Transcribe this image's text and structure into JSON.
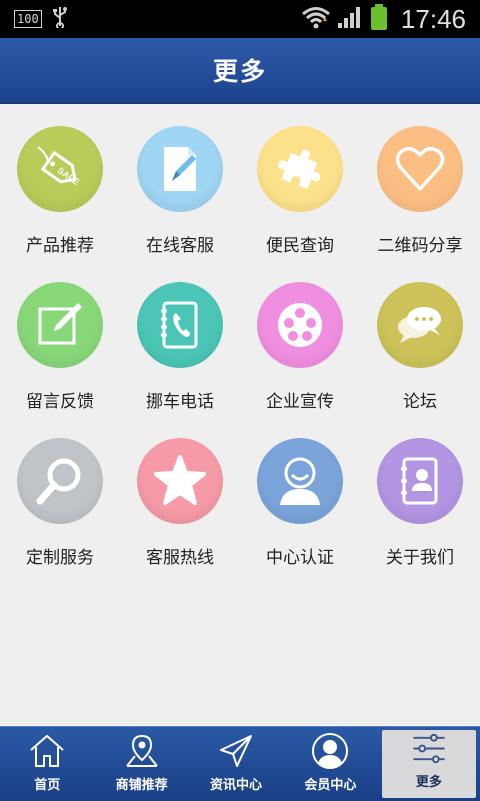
{
  "status": {
    "battery_badge": "100",
    "time": "17:46"
  },
  "header": {
    "title": "更多"
  },
  "grid": [
    {
      "label": "产品推荐",
      "icon": "sale-tag-icon",
      "color": "#b9cc5a"
    },
    {
      "label": "在线客服",
      "icon": "document-pen-icon",
      "color": "#9fd6f3"
    },
    {
      "label": "便民查询",
      "icon": "puzzle-icon",
      "color": "#fde18a"
    },
    {
      "label": "二维码分享",
      "icon": "heart-icon",
      "color": "#fbbf84"
    },
    {
      "label": "留言反馈",
      "icon": "edit-note-icon",
      "color": "#88d87a"
    },
    {
      "label": "挪车电话",
      "icon": "phone-book-icon",
      "color": "#4bc6b6"
    },
    {
      "label": "企业宣传",
      "icon": "film-reel-icon",
      "color": "#f08fe0"
    },
    {
      "label": "论坛",
      "icon": "chat-bubbles-icon",
      "color": "#cdc35a"
    },
    {
      "label": "定制服务",
      "icon": "magnifier-icon",
      "color": "#bfc4c8"
    },
    {
      "label": "客服热线",
      "icon": "star-icon",
      "color": "#f69aa7"
    },
    {
      "label": "中心认证",
      "icon": "user-icon",
      "color": "#7aa4da"
    },
    {
      "label": "关于我们",
      "icon": "contact-card-icon",
      "color": "#b295e3"
    }
  ],
  "nav": [
    {
      "label": "首页",
      "icon": "home-icon"
    },
    {
      "label": "商铺推荐",
      "icon": "map-pin-icon"
    },
    {
      "label": "资讯中心",
      "icon": "paper-plane-icon"
    },
    {
      "label": "会员中心",
      "icon": "member-icon"
    },
    {
      "label": "更多",
      "icon": "settings-sliders-icon",
      "active": true
    }
  ]
}
